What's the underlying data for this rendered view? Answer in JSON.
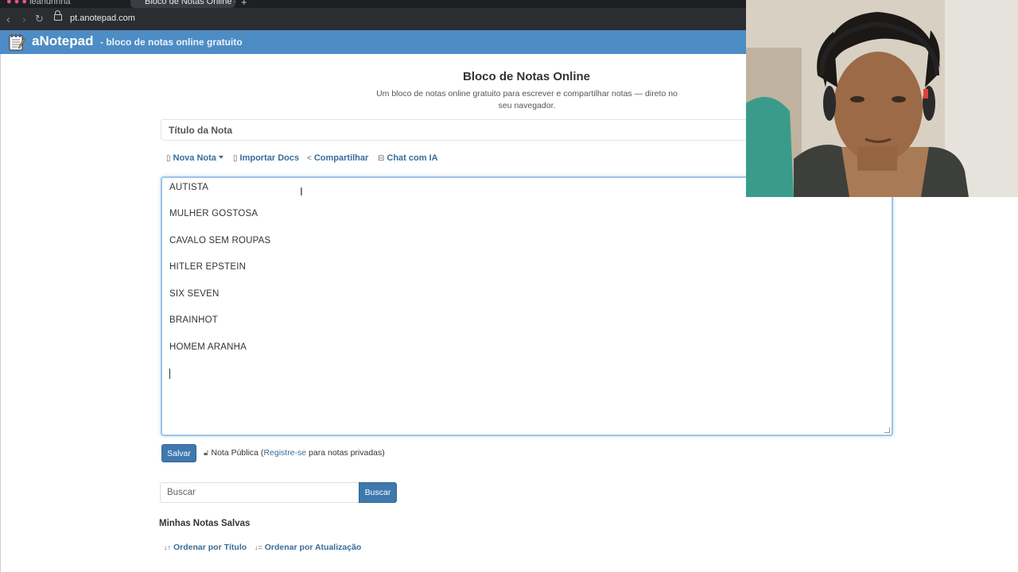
{
  "browser": {
    "tab_inactive_label": "leandrinha",
    "tab_active_label": "Bloco de Notas Online - C",
    "new_tab_glyph": "+",
    "url": "pt.anotepad.com",
    "icons": [
      "back-icon",
      "forward-icon",
      "reload-icon",
      "lock-icon"
    ]
  },
  "header": {
    "logo_text": "aNotepad",
    "tagline": "- bloco de notas online gratuito",
    "background_color": "#4d8cc4"
  },
  "page": {
    "title": "Bloco de Notas Online",
    "subtitle": "Um bloco de notas online gratuito para escrever e compartilhar notas — direto no seu navegador."
  },
  "note": {
    "title_placeholder": "Título da Nota",
    "lines": [
      "AUTISTA",
      "MULHER GOSTOSA",
      "CAVALO SEM ROUPAS",
      "HITLER EPSTEIN",
      "SIX SEVEN",
      "BRAINHOT",
      "HOMEM ARANHA"
    ]
  },
  "toolbar": {
    "new_note": "Nova Nota",
    "import_docs": "Importar Docs",
    "share": "Compartilhar",
    "ai_chat": "Chat com IA"
  },
  "save": {
    "button_label": "Salvar",
    "public_prefix": "Nota Pública (",
    "register_link": "Registre-se",
    "public_suffix": " para notas privadas)"
  },
  "search": {
    "placeholder": "Buscar",
    "button_label": "Buscar"
  },
  "saved_notes": {
    "title": "Minhas Notas Salvas",
    "sort_by_title": "Ordenar por Título",
    "sort_by_update": "Ordenar por Atualização"
  },
  "colors": {
    "accent": "#3f78ad",
    "link": "#3a6d99",
    "editor_focus_border": "#9ec3e6"
  }
}
